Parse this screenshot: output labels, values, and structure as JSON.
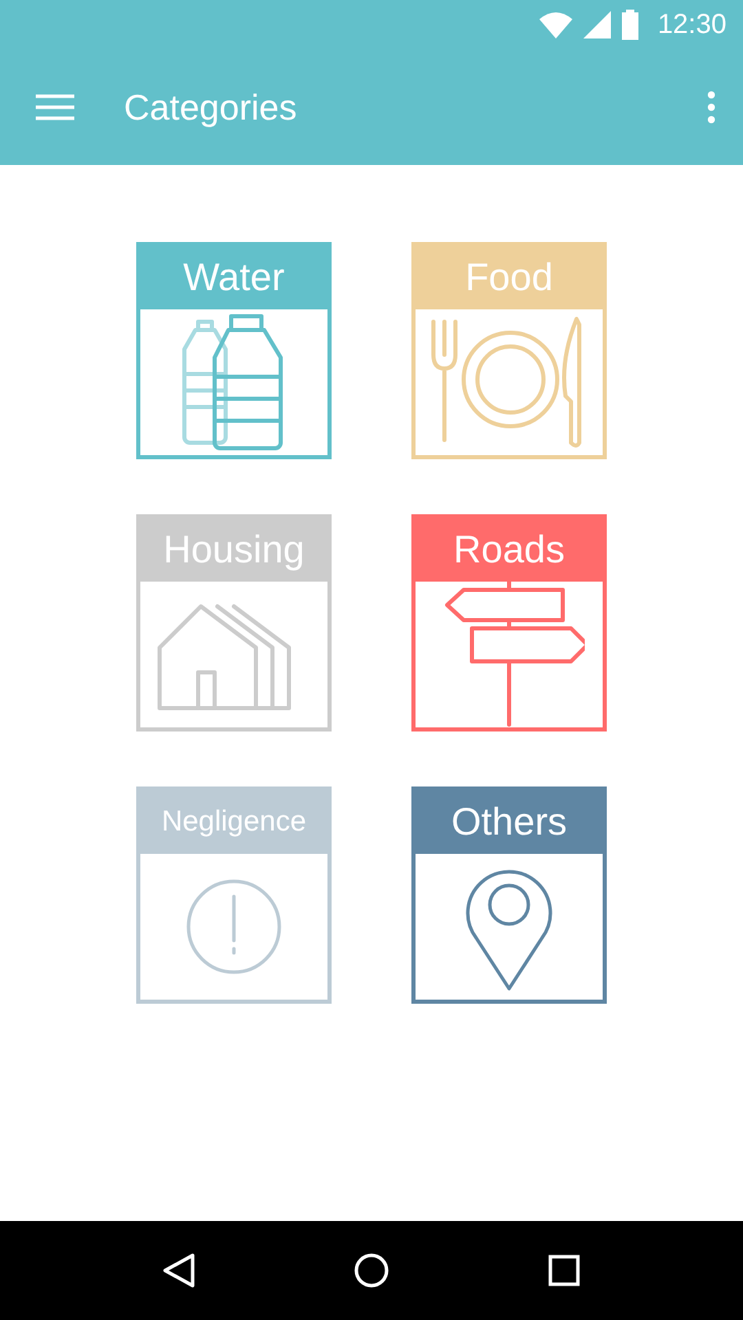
{
  "status_bar": {
    "time": "12:30"
  },
  "toolbar": {
    "title": "Categories"
  },
  "categories": [
    {
      "label": "Water",
      "kind": "water",
      "color": "#62c0ca"
    },
    {
      "label": "Food",
      "kind": "food",
      "color": "#eed09a"
    },
    {
      "label": "Housing",
      "kind": "housing",
      "color": "#cccccc"
    },
    {
      "label": "Roads",
      "kind": "roads",
      "color": "#ff6b6b"
    },
    {
      "label": "Negligence",
      "kind": "negligence",
      "color": "#bccbd5"
    },
    {
      "label": "Others",
      "kind": "others",
      "color": "#5f86a3"
    }
  ]
}
